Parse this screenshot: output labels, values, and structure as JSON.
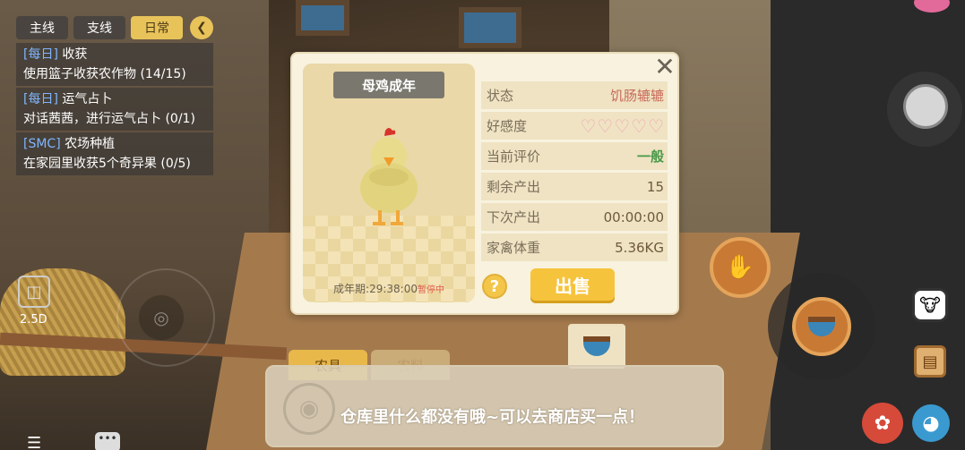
{
  "quest_tabs": {
    "main": "主线",
    "side": "支线",
    "daily": "日常",
    "collapse_icon": "chevron-left-icon"
  },
  "quests": [
    {
      "tag": "[每日]",
      "title": "收获",
      "desc": "使用篮子收获农作物 (14/15)"
    },
    {
      "tag": "[每日]",
      "title": "运气占卜",
      "desc": "对话茜茜，进行运气占卜 (0/1)"
    },
    {
      "tag": "[SMC]",
      "title": "农场种植",
      "desc": "在家园里收获5个奇异果 (0/5)"
    }
  ],
  "camera": {
    "label": "2.5D"
  },
  "animal_panel": {
    "name": "母鸡成年",
    "grow_label": "成年期:",
    "grow_time": "29:38:00",
    "grow_status": "暂停中",
    "rows": [
      {
        "key": "状态",
        "value": "饥肠辘辘"
      },
      {
        "key": "好感度",
        "value": "",
        "hearts": 5
      },
      {
        "key": "当前评价",
        "value": "一般"
      },
      {
        "key": "剩余产出",
        "value": "15"
      },
      {
        "key": "下次产出",
        "value": "00:00:00"
      },
      {
        "key": "家禽体重",
        "value": "5.36KG"
      }
    ],
    "help": "?",
    "sell": "出售"
  },
  "bottom_tabs": {
    "tools": "农具",
    "feed": "农料"
  },
  "message": "仓库里什么都没有哦~可以去商店买一点！",
  "colors": {
    "accent": "#f6c33c",
    "panel": "#f8f2df",
    "hearts": "#f2a6b2"
  }
}
